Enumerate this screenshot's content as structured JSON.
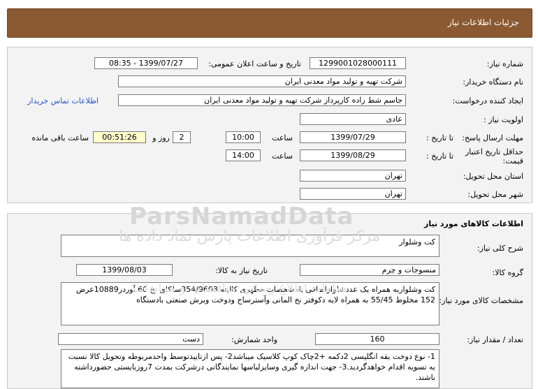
{
  "header": {
    "title": "جزئیات اطلاعات نیاز"
  },
  "need": {
    "number_label": "شماره نیاز:",
    "number": "1299001028000111",
    "announce_label": "تاریخ و ساعت اعلان عمومی:",
    "announce": "1399/07/27 - 08:35",
    "buyer_label": "نام دستگاه خریدار:",
    "buyer": "شرکت تهیه و تولید مواد معدنی ایران",
    "creator_label": "ایجاد کننده درخواست:",
    "creator": "جاسم شط زاده کارپرداز شرکت تهیه و تولید مواد معدنی ایران",
    "contact_link": "اطلاعات تماس خریدار",
    "priority_label": "اولویت نیاز :",
    "priority": "عادی",
    "deadline_label": "مهلت ارسال پاسخ:",
    "to_date_label": "تا تاریخ :",
    "deadline_date": "1399/07/29",
    "time_label": "ساعت",
    "deadline_time": "10:00",
    "days_value": "2",
    "days_label": "روز و",
    "remaining": "00:51:26",
    "remaining_label": "ساعت باقی مانده",
    "validity_label": "حداقل تاریخ اعتبار",
    "validity_label2": "قیمت:",
    "validity_to_label": "تا تاریخ :",
    "validity_date": "1399/08/29",
    "validity_time_label": "ساعت",
    "validity_time": "14:00",
    "province_label": "استان محل تحویل:",
    "province": "تهران",
    "city_label": "شهر محل تحویل:",
    "city": "تهران"
  },
  "goods": {
    "section_title": "اطلاعات کالاهای مورد نیاز",
    "summary_label": "شرح کلی نیاز:",
    "summary": "کت وشلوار",
    "group_label": "گروه کالا:",
    "group": "منسوجات و چرم",
    "need_date_label": "تاریخ نیاز به کالا:",
    "need_date": "1399/08/03",
    "spec_label": "مشخصات کالای مورد نیاز:",
    "spec": "کت وشلواربه همراه یک عددشلواراضافی بامشخصات مطهری کالیته 354/9603سلکای نخ 60 آوردر10889عرض 152 مخلوط 55/45 به همراه لایه دکوفتر نخ المانی وآسترساج ودوخت وبرش صنعتی بادستگاه",
    "qty_label": "تعداد / مقدار نیاز:",
    "qty": "160",
    "unit_label": "واحد شمارش:",
    "unit": "دست",
    "notes": "1- نوع دوخت یقه انگلیسی 2دکمه +2چاک کوپ کلاسیک میباشد2- پس ازتاییدتوسط واحدمربوطه وتحویل کالا نسبت به تسویه اقدام خواهدگردید.3- جهت اندازه گیری وسایزلباسها نمایندگانی درشرکت بمدت 7روزبایستی حضورداشته باشند."
  },
  "watermark": {
    "brand": "ParsNamadData",
    "line1": "مرکز فرآوری اطلاعات پارس نماد داده ها",
    "line2": "سامانه اطلاع رسانی مناقصات و مزایدات"
  }
}
